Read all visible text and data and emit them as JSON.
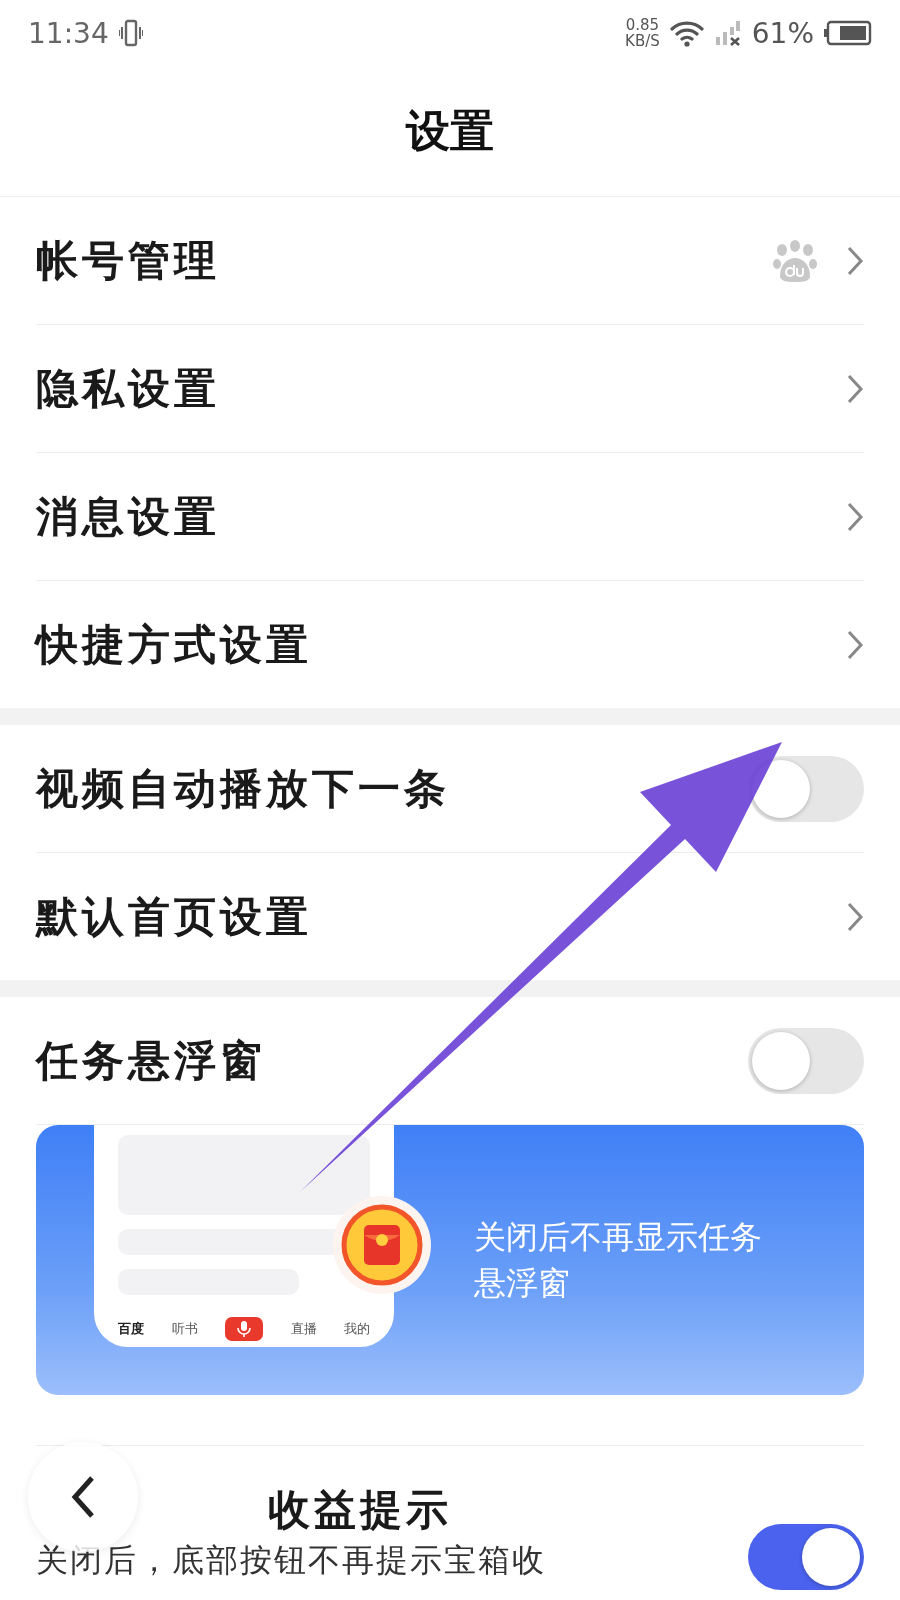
{
  "status_bar": {
    "time": "11:34",
    "net_speed": "0.85",
    "net_unit": "KB/S",
    "battery": "61%"
  },
  "title": "设置",
  "sections": [
    {
      "items": [
        {
          "kind": "account",
          "label": "帐号管理"
        },
        {
          "kind": "link",
          "label": "隐私设置"
        },
        {
          "kind": "link",
          "label": "消息设置"
        },
        {
          "kind": "link",
          "label": "快捷方式设置"
        }
      ]
    },
    {
      "items": [
        {
          "kind": "toggle",
          "label": "视频自动播放下一条",
          "on": false
        },
        {
          "kind": "link",
          "label": "默认首页设置"
        }
      ]
    },
    {
      "items": [
        {
          "kind": "toggle",
          "label": "任务悬浮窗",
          "on": false
        },
        {
          "kind": "banner",
          "text": "关闭后不再显示任务悬浮窗",
          "tabs": [
            "百度",
            "听书",
            "直播",
            "我的"
          ]
        },
        {
          "kind": "toggle",
          "label": "收益提示",
          "note": "关闭后，底部按钮不再提示宝箱收",
          "on": true
        }
      ]
    }
  ]
}
